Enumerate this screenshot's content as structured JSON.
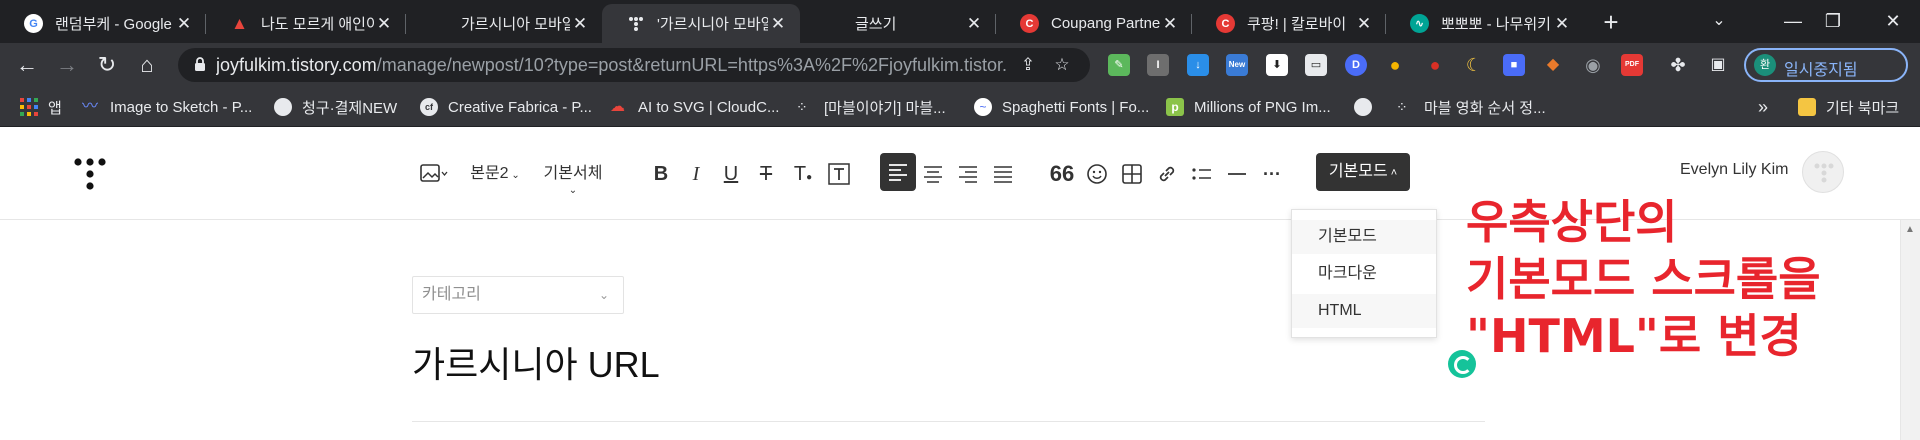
{
  "browser": {
    "tabs": [
      {
        "title": "랜덤부케 - Google",
        "favicon": "google-icon",
        "color": "#ffffff",
        "fg": "#4285f4",
        "glyph": "G",
        "active": false
      },
      {
        "title": "나도 모르게 애인이",
        "favicon": "flask-icon",
        "color": "#e8453c",
        "fg": "#ffffff",
        "glyph": "▲",
        "active": false
      },
      {
        "title": "가르시니아 모바일",
        "favicon": "",
        "color": "",
        "fg": "",
        "glyph": "",
        "active": false
      },
      {
        "title": "'가르시니아 모바일",
        "favicon": "tistory-icon",
        "color": "#35363a",
        "fg": "#ffffff",
        "glyph": "⁘",
        "active": true
      },
      {
        "title": "글쓰기",
        "favicon": "",
        "color": "",
        "fg": "",
        "glyph": "",
        "active": false
      },
      {
        "title": "Coupang Partners",
        "favicon": "coupang-icon",
        "color": "#e53935",
        "fg": "#ffffff",
        "glyph": "C",
        "active": false
      },
      {
        "title": "쿠팡! | 칼로바이",
        "favicon": "coupang-icon",
        "color": "#e53935",
        "fg": "#ffffff",
        "glyph": "C",
        "active": false
      },
      {
        "title": "뽀뽀뽀 - 나무위키",
        "favicon": "namuwiki-icon",
        "color": "#00a495",
        "fg": "#ffffff",
        "glyph": "∿",
        "active": false
      }
    ],
    "url": {
      "host": "joyfulkim.tistory.com",
      "path": "/manage/newpost/10?type=post&returnURL=https%3A%2F%2Fjoyfulkim.tistor..."
    },
    "profile_label": "일시중지됨",
    "profile_initial": "환",
    "extensions": [
      {
        "name": "ext-green-icon",
        "color": "#5cb85c",
        "glyph": "✎"
      },
      {
        "name": "ext-gray-icon",
        "color": "#6e6e6e",
        "glyph": "I"
      },
      {
        "name": "ext-download-icon",
        "color": "#2a8ee8",
        "glyph": "↓"
      },
      {
        "name": "ext-new-icon",
        "color": "#3a7bd5",
        "glyph": "New"
      },
      {
        "name": "ext-shield-icon",
        "color": "#ffffff",
        "glyph": "⬇"
      },
      {
        "name": "ext-dark-icon",
        "color": "#e8eaed",
        "glyph": "▭"
      },
      {
        "name": "ext-d-icon",
        "color": "#4a6cf7",
        "glyph": "D"
      },
      {
        "name": "ext-balloon-icon",
        "color": "#f4b400",
        "glyph": "●"
      },
      {
        "name": "ext-red-icon",
        "color": "#d93025",
        "glyph": "●"
      },
      {
        "name": "ext-moon-icon",
        "color": "#35363a",
        "glyph": "☾"
      },
      {
        "name": "ext-blue-icon",
        "color": "#4a6cf7",
        "glyph": "■"
      },
      {
        "name": "ext-fox-icon",
        "color": "#e97a2b",
        "glyph": "◆"
      },
      {
        "name": "ext-circle-icon",
        "color": "#80868b",
        "glyph": "◉"
      },
      {
        "name": "ext-pdf-icon",
        "color": "#e53935",
        "glyph": "PDF"
      }
    ],
    "bookmarks": [
      {
        "label": "앱",
        "icon": "apps-icon",
        "color": "#e8453c"
      },
      {
        "label": "Image to Sketch - P...",
        "icon": "sketch-icon",
        "color": "#4a6cf7"
      },
      {
        "label": "청구·결제NEW",
        "icon": "globe-icon",
        "color": "#e8eaed"
      },
      {
        "label": "Creative Fabrica - P...",
        "icon": "cf-icon",
        "color": "#e8eaed"
      },
      {
        "label": "AI to SVG | CloudC...",
        "icon": "cloud-icon",
        "color": "#e8453c"
      },
      {
        "label": "[마블이야기] 마블...",
        "icon": "tistory-icon",
        "color": "#e8eaed"
      },
      {
        "label": "Spaghetti Fonts | Fo...",
        "icon": "spaghetti-icon",
        "color": "#4a6cf7"
      },
      {
        "label": "Millions of PNG Im...",
        "icon": "png-icon",
        "color": "#8bc34a"
      },
      {
        "label": "",
        "icon": "globe-icon",
        "color": "#e8eaed"
      },
      {
        "label": "마블 영화 순서 정...",
        "icon": "tistory-icon",
        "color": "#e8eaed"
      }
    ],
    "bookmarks_overflow": "»",
    "other_bookmarks": "기타 북마크"
  },
  "editor": {
    "paragraph_style": "본문2",
    "font": "기본서체",
    "mode_label": "기본모드",
    "user_name": "Evelyn Lily Kim",
    "mode_options": [
      "기본모드",
      "마크다운",
      "HTML"
    ],
    "category_placeholder": "카테고리",
    "post_title": "가르시니아 URL"
  },
  "annotation": {
    "lines": [
      "우측상단의",
      "기본모드 스크롤을",
      "\"HTML\"로 변경"
    ],
    "color": "#e8252d"
  }
}
